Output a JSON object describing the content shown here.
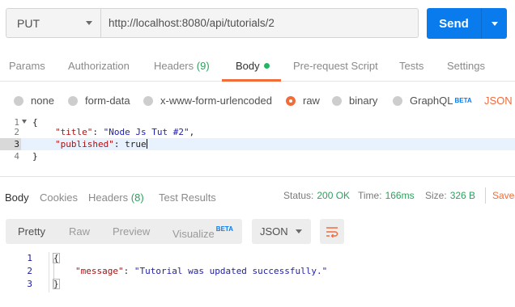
{
  "request": {
    "method": "PUT",
    "url": "http://localhost:8080/api/tutorials/2",
    "send_label": "Send"
  },
  "request_tabs": [
    {
      "label": "Params"
    },
    {
      "label": "Authorization"
    },
    {
      "label": "Headers",
      "count": "(9)"
    },
    {
      "label": "Body",
      "active": true
    },
    {
      "label": "Pre-request Script"
    },
    {
      "label": "Tests"
    },
    {
      "label": "Settings"
    }
  ],
  "body_types": {
    "options": [
      "none",
      "form-data",
      "x-www-form-urlencoded",
      "raw",
      "binary",
      "GraphQL"
    ],
    "selected": "raw",
    "beta": "BETA",
    "format": "JSON"
  },
  "editor": {
    "lines": [
      {
        "num": "1",
        "code": "{"
      },
      {
        "num": "2",
        "key": "\"title\"",
        "sep": ": ",
        "val": "\"Node Js Tut #2\"",
        "end": ","
      },
      {
        "num": "3",
        "key": "\"published\"",
        "sep": ": ",
        "val": "true",
        "end": ""
      },
      {
        "num": "4",
        "code": "}"
      }
    ]
  },
  "response_tabs": [
    {
      "label": "Body",
      "active": true
    },
    {
      "label": "Cookies"
    },
    {
      "label": "Headers",
      "count": "(8)"
    },
    {
      "label": "Test Results"
    }
  ],
  "response_meta": {
    "status_label": "Status:",
    "status_value": "200 OK",
    "time_label": "Time:",
    "time_value": "166ms",
    "size_label": "Size:",
    "size_value": "326 B",
    "save_label": "Save"
  },
  "view_options": {
    "items": [
      "Pretty",
      "Raw",
      "Preview",
      "Visualize"
    ],
    "beta": "BETA",
    "format": "JSON"
  },
  "response_body": {
    "lines": [
      {
        "num": "1",
        "code": "{"
      },
      {
        "num": "2",
        "key": "\"message\"",
        "sep": ": ",
        "val": "\"Tutorial was updated successfully.\""
      },
      {
        "num": "3",
        "code": "}"
      }
    ]
  },
  "colors": {
    "accent": "#f26b3a",
    "send": "#097bed",
    "green": "#2fa05f"
  }
}
